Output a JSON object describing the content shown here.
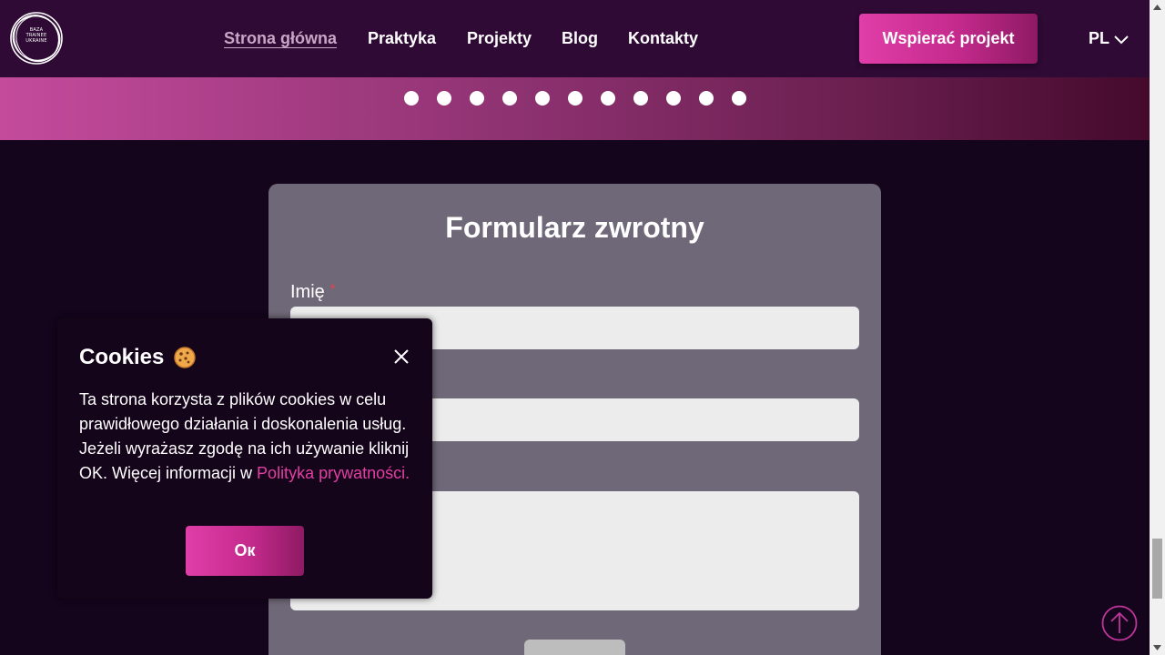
{
  "header": {
    "logo_text": [
      "BAZA",
      "TRAINEE",
      "UKRAINE"
    ],
    "nav": [
      {
        "label": "Strona główna",
        "active": true
      },
      {
        "label": "Praktyka",
        "active": false
      },
      {
        "label": "Projekty",
        "active": false
      },
      {
        "label": "Blog",
        "active": false
      },
      {
        "label": "Kontakty",
        "active": false
      }
    ],
    "support_button": "Wspierać projekt",
    "language": "PL"
  },
  "banner": {
    "slide_count": 11
  },
  "form": {
    "title": "Formularz zwrotny",
    "name_label": "Imię",
    "required_mark": "*"
  },
  "cookie": {
    "title": "Cookies",
    "text": "Ta strona korzysta z plików cookies w celu prawidłowego działania i doskonalenia usług. Jeżeli wyrażasz zgodę na ich używanie kliknij OK. Więcej informacji w ",
    "link": "Polityka prywatności.",
    "ok_button": "Ок"
  },
  "colors": {
    "accent": "#e03ea8",
    "header_bg": "#2e0a34",
    "page_bg": "#14041c",
    "card_bg": "#6f6878"
  }
}
